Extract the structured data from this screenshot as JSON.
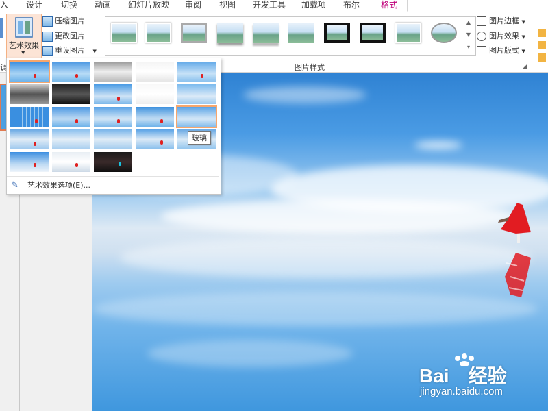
{
  "tabs": [
    "入",
    "设计",
    "切换",
    "动画",
    "幻灯片放映",
    "审阅",
    "视图",
    "开发工具",
    "加载项",
    "布尔",
    "格式"
  ],
  "active_tab": "格式",
  "adjust": {
    "art_effects_label": "艺术效果",
    "compress_label": "压缩图片",
    "change_label": "更改图片",
    "reset_label": "重设图片",
    "left_cut_label": "调"
  },
  "picture_styles": {
    "group_label": "图片样式",
    "count": 10
  },
  "right_commands": {
    "border": "图片边框",
    "effects": "图片效果",
    "layout": "图片版式"
  },
  "artistic_menu": {
    "tooltip": "玻璃",
    "options_label": "艺术效果选项(E)...",
    "effects_count": 23
  },
  "watermark": {
    "brand": "Bai",
    "brand_suffix": "经验",
    "url": "jingyan.baidu.com"
  },
  "colors": {
    "accent": "#c0007a",
    "selection": "#f7a66c",
    "sky": "#4a9be4"
  }
}
